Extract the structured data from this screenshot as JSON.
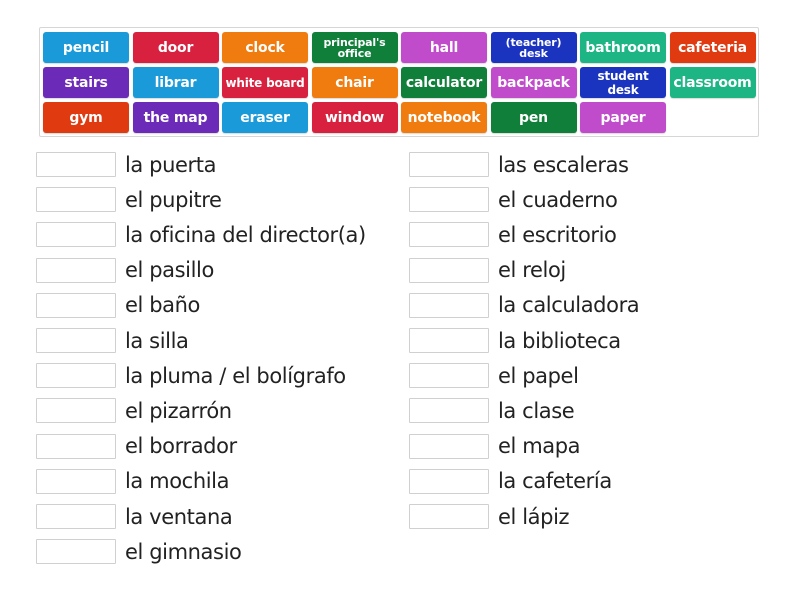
{
  "tiles": [
    {
      "label": "pencil",
      "color": "#1a9ad8"
    },
    {
      "label": "door",
      "color": "#d8203f"
    },
    {
      "label": "clock",
      "color": "#f07b0f"
    },
    {
      "label": "principal's office",
      "color": "#0f7f3a"
    },
    {
      "label": "hall",
      "color": "#c04ccc"
    },
    {
      "label": "(teacher) desk",
      "color": "#1b34c0"
    },
    {
      "label": "bathroom",
      "color": "#1db584"
    },
    {
      "label": "cafeteria",
      "color": "#e03a10"
    },
    {
      "label": "stairs",
      "color": "#6c2ab8"
    },
    {
      "label": "librar",
      "color": "#1a9ad8"
    },
    {
      "label": "white board",
      "color": "#d8203f"
    },
    {
      "label": "chair",
      "color": "#f07b0f"
    },
    {
      "label": "calculator",
      "color": "#0f7f3a"
    },
    {
      "label": "backpack",
      "color": "#c04ccc"
    },
    {
      "label": "student desk",
      "color": "#1b34c0"
    },
    {
      "label": "classroom",
      "color": "#1db584"
    },
    {
      "label": "gym",
      "color": "#e03a10"
    },
    {
      "label": "the map",
      "color": "#6c2ab8"
    },
    {
      "label": "eraser",
      "color": "#1a9ad8"
    },
    {
      "label": "window",
      "color": "#d8203f"
    },
    {
      "label": "notebook",
      "color": "#f07b0f"
    },
    {
      "label": "pen",
      "color": "#0f7f3a"
    },
    {
      "label": "paper",
      "color": "#c04ccc"
    }
  ],
  "left_items": [
    "la puerta",
    "el pupitre",
    "la oficina del director(a)",
    "el pasillo",
    "el baño",
    "la silla",
    "la pluma / el bolígrafo",
    "el pizarrón",
    "el borrador",
    "la mochila",
    "la ventana",
    "el gimnasio"
  ],
  "right_items": [
    "las escaleras",
    "el cuaderno",
    "el escritorio",
    "el reloj",
    "la calculadora",
    "la biblioteca",
    "el papel",
    "la clase",
    "el mapa",
    "la cafetería",
    "el lápiz"
  ]
}
